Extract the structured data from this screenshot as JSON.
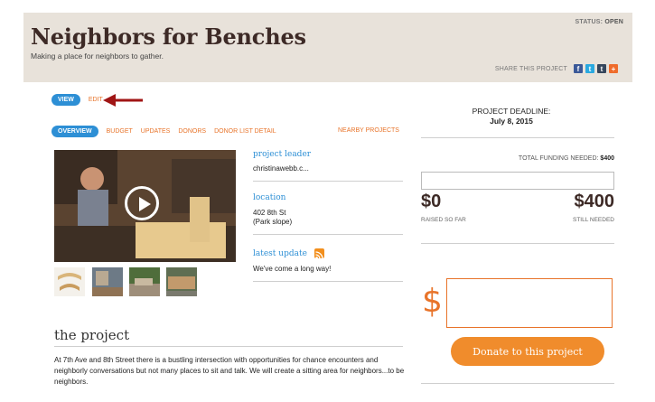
{
  "header": {
    "status_label": "STATUS:",
    "status_value": "OPEN",
    "title": "Neighbors for Benches",
    "tagline": "Making a place for neighbors to gather.",
    "share_label": "SHARE THIS PROJECT",
    "share_icons": [
      "facebook-icon",
      "twitter-icon",
      "tumblr-icon",
      "plus-icon"
    ],
    "share_glyphs": [
      "f",
      "t",
      "t",
      "+"
    ],
    "share_colors": [
      "#3b5998",
      "#2aa9e0",
      "#35465c",
      "#ef6c2c"
    ]
  },
  "mode": {
    "view": "VIEW",
    "edit": "EDIT"
  },
  "tabs": {
    "overview": "OVERVIEW",
    "budget": "BUDGET",
    "updates": "UPDATES",
    "donors": "DONORS",
    "donor_list": "DONOR LIST DETAIL",
    "nearby": "NEARBY PROJECTS"
  },
  "sidebar": {
    "leader_heading": "project leader",
    "leader_value": "christinawebb.c...",
    "location_heading": "location",
    "location_line1": "402 8th St",
    "location_line2": "(Park slope)",
    "update_heading": "latest update",
    "update_value": "We've come a long way!"
  },
  "project": {
    "heading": "the project",
    "text": "At 7th Ave and 8th Street there is a bustling intersection with opportunities for chance encounters and neighborly conversations but not many places to sit and talk.  We will create a sitting area for neighbors...to be neighbors."
  },
  "funding": {
    "deadline_label": "PROJECT DEADLINE:",
    "deadline_date": "July 8, 2015",
    "total_label": "TOTAL FUNDING NEEDED:",
    "total_value": "$400",
    "raised_amount": "$0",
    "raised_label": "RAISED SO FAR",
    "needed_amount": "$400",
    "needed_label": "STILL NEEDED",
    "currency_symbol": "$",
    "donate_label": "Donate to this project"
  },
  "colors": {
    "accent": "#e8742a",
    "blue": "#2d8fd5",
    "brand_dark": "#3d2a26",
    "header_bg": "#e8e2da"
  }
}
